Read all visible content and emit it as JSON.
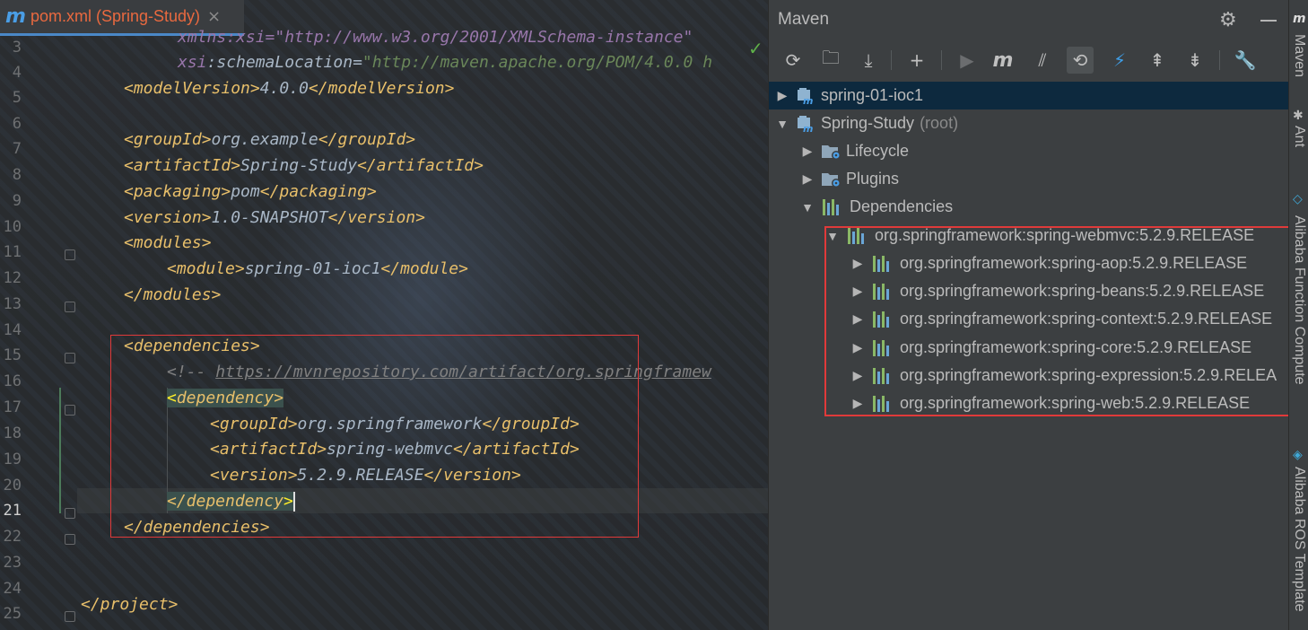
{
  "editor": {
    "tab": {
      "icon": "maven-m-icon",
      "label": "pom.xml (Spring-Study)",
      "close": "×",
      "color": "#e9693f"
    },
    "gutter": [
      "3",
      "4",
      "5",
      "6",
      "7",
      "8",
      "9",
      "10",
      "11",
      "12",
      "13",
      "14",
      "15",
      "16",
      "17",
      "18",
      "19",
      "20",
      "21",
      "22",
      "23",
      "24",
      "25"
    ],
    "current_line": "21",
    "lines": {
      "l3": "xmlns:xsi=\"http://www.w3.org/2001/XMLSchema-instance\"",
      "l4_attr": "xsi",
      "l4_attr2": ":schemaLocation",
      "l4_eq": "=",
      "l4_val": "\"http://maven.apache.org/POM/4.0.0 h",
      "l5_open": "<modelVersion>",
      "l5_text": "4.0.0",
      "l5_close": "</modelVersion>",
      "l7_open": "<groupId>",
      "l7_text": "org.example",
      "l7_close": "</groupId>",
      "l8_open": "<artifactId>",
      "l8_text": "Spring-Study",
      "l8_close": "</artifactId>",
      "l9_open": "<packaging>",
      "l9_text": "pom",
      "l9_close": "</packaging>",
      "l10_open": "<version>",
      "l10_text": "1.0-SNAPSHOT",
      "l10_close": "</version>",
      "l11": "<modules>",
      "l12_open": "<module>",
      "l12_text": "spring-01-ioc1",
      "l12_close": "</module>",
      "l13": "</modules>",
      "l15": "<dependencies>",
      "l16_comment": "<!-- ",
      "l16_url": "https://mvnrepository.com/artifact/org.springframew",
      "l17_lt": "<",
      "l17_tag": "dependency",
      "l17_gt": ">",
      "l18_open": "<groupId>",
      "l18_text": "org.springframework",
      "l18_close": "</groupId>",
      "l19_open": "<artifactId>",
      "l19_text": "spring-webmvc",
      "l19_close": "</artifactId>",
      "l20_open": "<version>",
      "l20_text": "5.2.9.RELEASE",
      "l20_close": "</version>",
      "l21_tag": "</dependency",
      "l21_gt": ">",
      "l22": "</dependencies>",
      "l25": "</project>"
    }
  },
  "maven": {
    "title": "Maven",
    "header_icons": [
      "gear-icon",
      "minimize-icon"
    ],
    "toolbar": [
      {
        "name": "reload-icon",
        "glyph": "⟳"
      },
      {
        "name": "add-folder-icon",
        "glyph": "🗀"
      },
      {
        "name": "download-icon",
        "glyph": "⤓"
      },
      {
        "name": "add-icon",
        "glyph": "+"
      },
      {
        "name": "run-icon",
        "glyph": "▶"
      },
      {
        "name": "maven-goal-icon",
        "glyph": "m"
      },
      {
        "name": "toggle-offline-icon",
        "glyph": "⫽"
      },
      {
        "name": "skip-tests-icon",
        "glyph": "⟲"
      },
      {
        "name": "show-deps-icon",
        "glyph": "⚡"
      },
      {
        "name": "expand-all-icon",
        "glyph": "⇞"
      },
      {
        "name": "collapse-all-icon",
        "glyph": "⇟"
      },
      {
        "name": "settings-wrench-icon",
        "glyph": "🔧"
      }
    ],
    "tree": [
      {
        "label": "spring-01-ioc1",
        "suffix": "",
        "arrow": "▶",
        "level": 0,
        "icon": "module-icon",
        "selected": true
      },
      {
        "label": "Spring-Study",
        "suffix": "(root)",
        "arrow": "▼",
        "level": 0,
        "icon": "module-icon"
      },
      {
        "label": "Lifecycle",
        "suffix": "",
        "arrow": "▶",
        "level": 1,
        "icon": "lifecycle-folder-icon"
      },
      {
        "label": "Plugins",
        "suffix": "",
        "arrow": "▶",
        "level": 1,
        "icon": "plugins-folder-icon"
      },
      {
        "label": "Dependencies",
        "suffix": "",
        "arrow": "▼",
        "level": 1,
        "icon": "dependencies-icon"
      },
      {
        "label": "org.springframework:spring-webmvc:5.2.9.RELEASE",
        "suffix": "",
        "arrow": "▼",
        "level": 2,
        "icon": "library-icon"
      },
      {
        "label": "org.springframework:spring-aop:5.2.9.RELEASE",
        "suffix": "",
        "arrow": "▶",
        "level": 3,
        "icon": "library-icon"
      },
      {
        "label": "org.springframework:spring-beans:5.2.9.RELEASE",
        "suffix": "",
        "arrow": "▶",
        "level": 3,
        "icon": "library-icon"
      },
      {
        "label": "org.springframework:spring-context:5.2.9.RELEASE",
        "suffix": "",
        "arrow": "▶",
        "level": 3,
        "icon": "library-icon"
      },
      {
        "label": "org.springframework:spring-core:5.2.9.RELEASE",
        "suffix": "",
        "arrow": "▶",
        "level": 3,
        "icon": "library-icon"
      },
      {
        "label": "org.springframework:spring-expression:5.2.9.RELEA",
        "suffix": "",
        "arrow": "▶",
        "level": 3,
        "icon": "library-icon"
      },
      {
        "label": "org.springframework:spring-web:5.2.9.RELEASE",
        "suffix": "",
        "arrow": "▶",
        "level": 3,
        "icon": "library-icon"
      }
    ]
  },
  "side_strip": {
    "items": [
      {
        "label": "Maven",
        "icon": "maven-m-icon"
      },
      {
        "label": "Ant",
        "icon": "ant-icon"
      },
      {
        "label": "Alibaba Function Compute",
        "icon": "alibaba-fc-icon"
      },
      {
        "label": "Alibaba ROS Template",
        "icon": "alibaba-ros-icon"
      }
    ]
  },
  "colors": {
    "highlight_box": "#e03a3a",
    "selection": "#0d293e",
    "accent": "#4a88c7"
  }
}
